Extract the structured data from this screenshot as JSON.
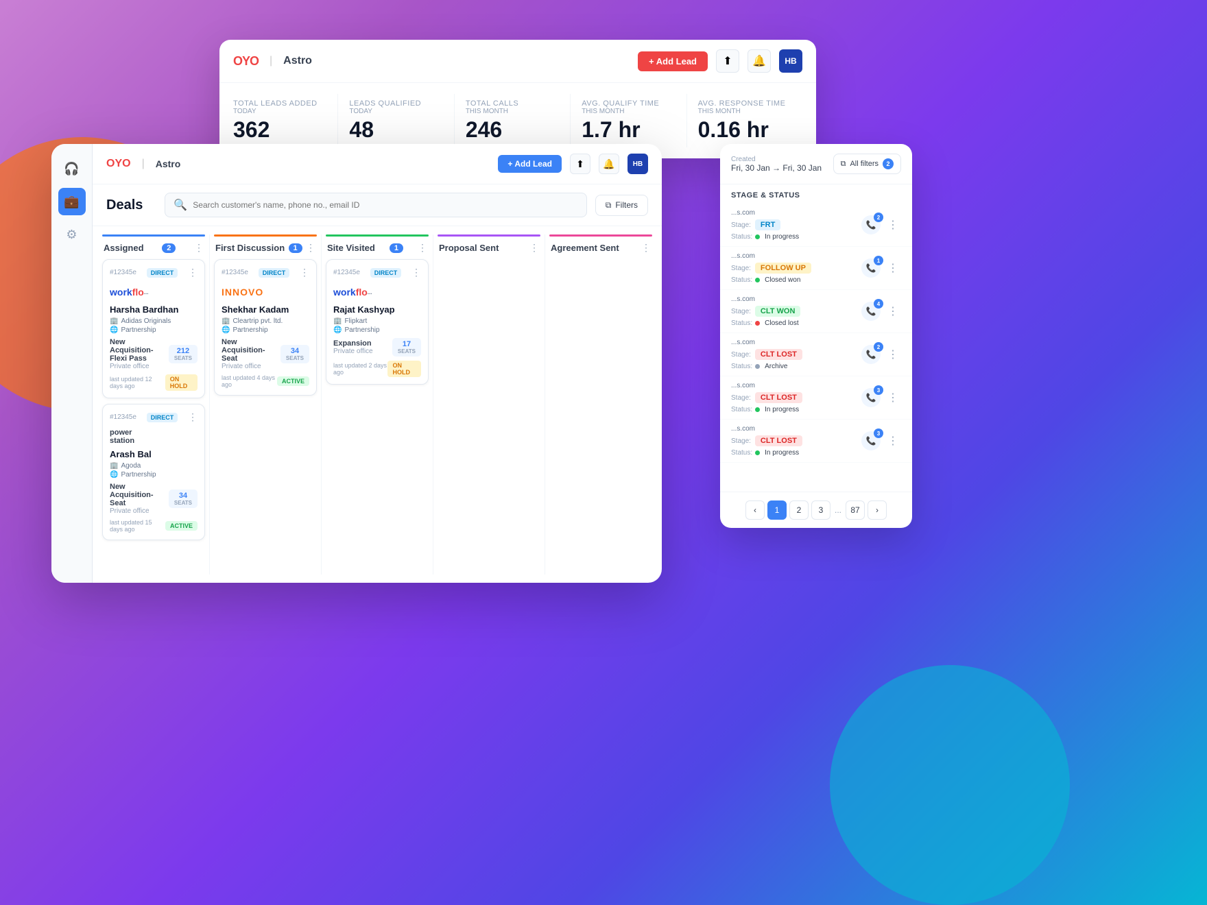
{
  "app": {
    "name": "OYO | Astro",
    "logo_red": "OYO",
    "logo_pipe": "|",
    "logo_astro": "Astro"
  },
  "header": {
    "add_lead_label": "+ Add Lead",
    "avatar_initials": "HB"
  },
  "stats": [
    {
      "label": "Total leads added",
      "period": "TODAY",
      "value": "362"
    },
    {
      "label": "Leads qualified",
      "period": "TODAY",
      "value": "48"
    },
    {
      "label": "Total calls",
      "period": "THIS MONTH",
      "value": "246"
    },
    {
      "label": "Avg. Qualify time",
      "period": "THIS MONTH",
      "value": "1.7 hr"
    },
    {
      "label": "Avg. Response time",
      "period": "THIS MONTH",
      "value": "0.16 hr"
    }
  ],
  "deals": {
    "title": "Deals",
    "search_placeholder": "Search customer's name, phone no., email ID",
    "filter_label": "Filters"
  },
  "kanban_columns": [
    {
      "title": "Assigned",
      "count": 2,
      "bar_color": "bar-blue",
      "cards": [
        {
          "id": "#12345e",
          "badge": "DIRECT",
          "logo_type": "workflo",
          "logo_text": "work flo",
          "name": "Harsha Bardhan",
          "company": "Adidas Originals",
          "type": "Partnership",
          "deal_name": "New Acquisition- Flexi Pass",
          "deal_type": "Private office",
          "seats": "212",
          "last_updated": "last updated 12 days ago",
          "status": "ON HOLD",
          "status_class": "badge-onhold"
        },
        {
          "id": "#12345e",
          "badge": "DIRECT",
          "logo_type": "powerstation",
          "logo_text": "power station",
          "name": "Arash Bal",
          "company": "Agoda",
          "type": "Partnership",
          "deal_name": "New Acquisition- Seat",
          "deal_type": "Private office",
          "seats": "34",
          "last_updated": "last updated 15 days ago",
          "status": "ACTIVE",
          "status_class": "badge-active"
        }
      ]
    },
    {
      "title": "First Discussion",
      "count": 1,
      "bar_color": "bar-orange",
      "cards": [
        {
          "id": "#12345e",
          "badge": "DIRECT",
          "logo_type": "innovo",
          "logo_text": "INNOVO",
          "name": "Shekhar Kadam",
          "company": "Cleartrip pvt. ltd.",
          "type": "Partnership",
          "deal_name": "New Acquisition- Seat",
          "deal_type": "Private office",
          "seats": "34",
          "last_updated": "last updated 4 days ago",
          "status": "ACTIVE",
          "status_class": "badge-active"
        }
      ]
    },
    {
      "title": "Site Visited",
      "count": 1,
      "bar_color": "bar-green",
      "cards": [
        {
          "id": "#12345e",
          "badge": "DIRECT",
          "logo_type": "workflo",
          "logo_text": "work flo",
          "name": "Rajat Kashyap",
          "company": "Flipkart",
          "type": "Partnership",
          "deal_name": "Expansion",
          "deal_type": "Private office",
          "seats": "17",
          "last_updated": "last updated 2 days ago",
          "status": "ON HOLD",
          "status_class": "badge-onhold"
        }
      ]
    },
    {
      "title": "Proposal Sent",
      "count": 0,
      "bar_color": "bar-purple",
      "cards": []
    },
    {
      "title": "Agreement Sent",
      "count": 0,
      "bar_color": "bar-pink",
      "cards": []
    }
  ],
  "filter_panel": {
    "created_label": "Created",
    "date_range": "Fri, 30 Jan → Fri, 30 Jan",
    "all_filters_label": "All filters",
    "filter_count": "2",
    "section_title": "STAGE & STATUS",
    "rows": [
      {
        "company": "...s.com",
        "stage": "FRT",
        "stage_class": "stage-frt",
        "status_label": "In progress",
        "status_dot": "dot-green",
        "call_count": "2"
      },
      {
        "company": "...s.com",
        "stage": "FOLLOW UP",
        "stage_class": "stage-follow",
        "status_label": "Closed won",
        "status_dot": "dot-green",
        "call_count": "1"
      },
      {
        "company": "...s.com",
        "stage": "CLT WON",
        "stage_class": "stage-won",
        "status_label": "Closed lost",
        "status_dot": "dot-red",
        "call_count": "4"
      },
      {
        "company": "...s.com",
        "stage": "CLT LOST",
        "stage_class": "stage-lost",
        "status_label": "Archive",
        "status_dot": "dot-gray",
        "call_count": "2"
      },
      {
        "company": "...s.com",
        "stage": "CLT LOST",
        "stage_class": "stage-lost",
        "status_label": "In progress",
        "status_dot": "dot-green",
        "call_count": "3"
      },
      {
        "company": "...s.com",
        "stage": "CLT LOST",
        "stage_class": "stage-lost",
        "status_label": "In progress",
        "status_dot": "dot-green",
        "call_count": "3"
      }
    ],
    "pagination": {
      "pages": [
        "1",
        "2",
        "3",
        "...",
        "87"
      ],
      "active_page": "1",
      "prev": "‹",
      "next": "›"
    }
  }
}
